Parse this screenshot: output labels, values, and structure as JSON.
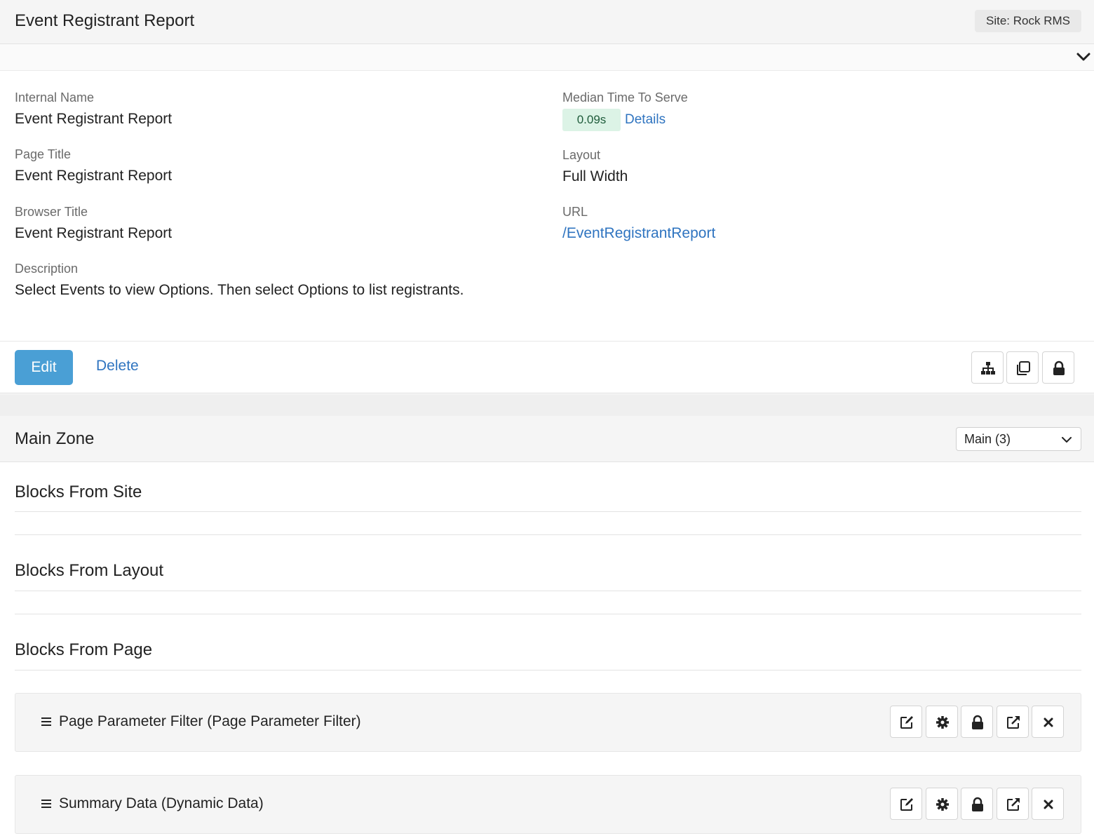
{
  "header": {
    "title": "Event Registrant Report",
    "site_badge": "Site: Rock RMS"
  },
  "details": {
    "internal_name_label": "Internal Name",
    "internal_name": "Event Registrant Report",
    "page_title_label": "Page Title",
    "page_title": "Event Registrant Report",
    "browser_title_label": "Browser Title",
    "browser_title": "Event Registrant Report",
    "description_label": "Description",
    "description": "Select Events to view Options. Then select Options to list registrants.",
    "median_label": "Median Time To Serve",
    "median_value": "0.09s",
    "details_link": "Details",
    "layout_label": "Layout",
    "layout_value": "Full Width",
    "url_label": "URL",
    "url_value": "/EventRegistrantReport"
  },
  "actions": {
    "edit_label": "Edit",
    "delete_label": "Delete",
    "icons": [
      "sitemap-icon",
      "copy-icon",
      "lock-icon"
    ]
  },
  "zone": {
    "title": "Main Zone",
    "selected": "Main (3)",
    "sections": {
      "site": "Blocks From Site",
      "layout": "Blocks From Layout",
      "page": "Blocks From Page"
    },
    "blocks": [
      {
        "name": "Page Parameter Filter (Page Parameter Filter)"
      },
      {
        "name": "Summary Data (Dynamic Data)"
      }
    ],
    "block_icons": [
      "edit-icon",
      "gear-icon",
      "lock-icon",
      "external-link-icon",
      "close-icon"
    ]
  },
  "colors": {
    "primary": "#4a9fd5",
    "link": "#2f74c0",
    "success_bg": "#dcf3e6"
  }
}
